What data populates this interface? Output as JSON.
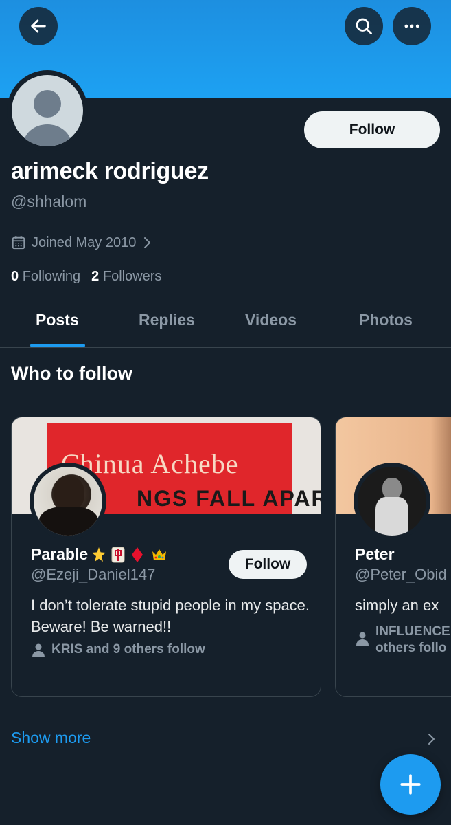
{
  "header": {
    "back_icon": "arrow-left-icon",
    "search_icon": "search-icon",
    "more_icon": "more-horizontal-icon",
    "banner_color": "#1da1f2"
  },
  "profile": {
    "display_name": "arimeck rodriguez",
    "handle": "@shhalom",
    "follow_label": "Follow",
    "joined": "Joined May 2010",
    "following_count": "0",
    "following_label": "Following",
    "followers_count": "2",
    "followers_label": "Followers"
  },
  "tabs": [
    {
      "label": "Posts",
      "active": true
    },
    {
      "label": "Replies",
      "active": false
    },
    {
      "label": "Videos",
      "active": false
    },
    {
      "label": "Photos",
      "active": false
    }
  ],
  "who_to_follow": {
    "title": "Who to follow",
    "cards": [
      {
        "banner_author": "Chinua Achebe",
        "banner_title": "NGS FALL APART",
        "name": "Parable",
        "name_emojis": [
          "star-emoji",
          "mahjong-red-dragon-emoji",
          "red-diamond-emoji",
          "crown-emoji"
        ],
        "handle": "@Ezeji_Daniel147",
        "follow_label": "Follow",
        "bio": "I don’t tolerate stupid people in my space. Beware! Be warned!!",
        "social_context": "KRIS and 9 others follow"
      },
      {
        "name": "Peter",
        "handle": "@Peter_Obid",
        "bio": "simply an ex",
        "social_context_line1": "INFLUENCE",
        "social_context_line2": "others follo"
      }
    ],
    "show_more_label": "Show more"
  },
  "fab": {
    "icon": "plus-icon",
    "color": "#1d9bf0"
  }
}
